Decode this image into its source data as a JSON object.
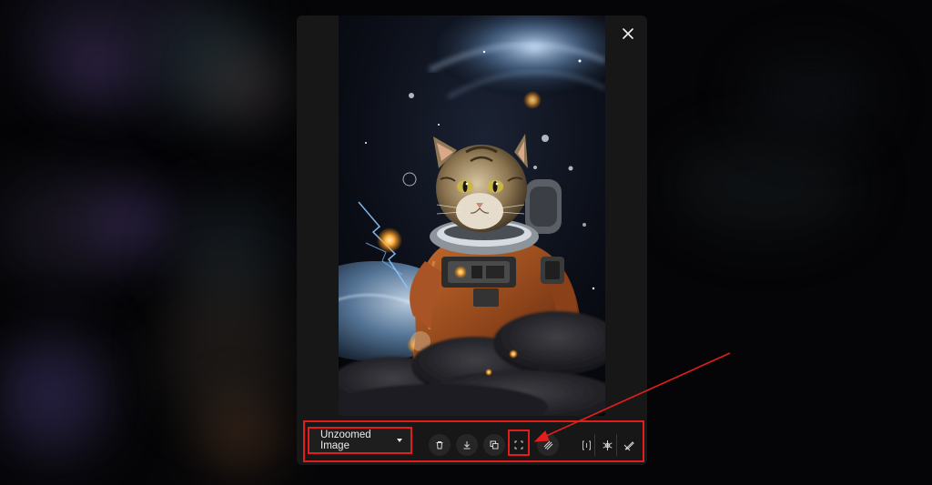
{
  "modal": {
    "close_icon": "close-icon",
    "image_description": "cat-astronaut-in-space"
  },
  "toolbar": {
    "mode_select": {
      "selected": "Unzoomed Image",
      "icon": "chevron-down-icon"
    },
    "buttons": [
      {
        "name": "delete-button",
        "icon": "trash-icon"
      },
      {
        "name": "download-button",
        "icon": "download-icon"
      },
      {
        "name": "copy-button",
        "icon": "copy-icon"
      },
      {
        "name": "expand-button",
        "icon": "expand-icon"
      },
      {
        "name": "pattern-button",
        "icon": "diagonal-lines-icon"
      },
      {
        "name": "variations-button",
        "icon": "bracket-icon"
      },
      {
        "name": "remix-button",
        "icon": "snowflake-icon"
      },
      {
        "name": "edit-button",
        "icon": "pencil-slash-icon"
      }
    ]
  },
  "colors": {
    "highlight": "#e01e1e",
    "modal_bg": "#171717",
    "toolbar_button_bg": "#262626"
  }
}
